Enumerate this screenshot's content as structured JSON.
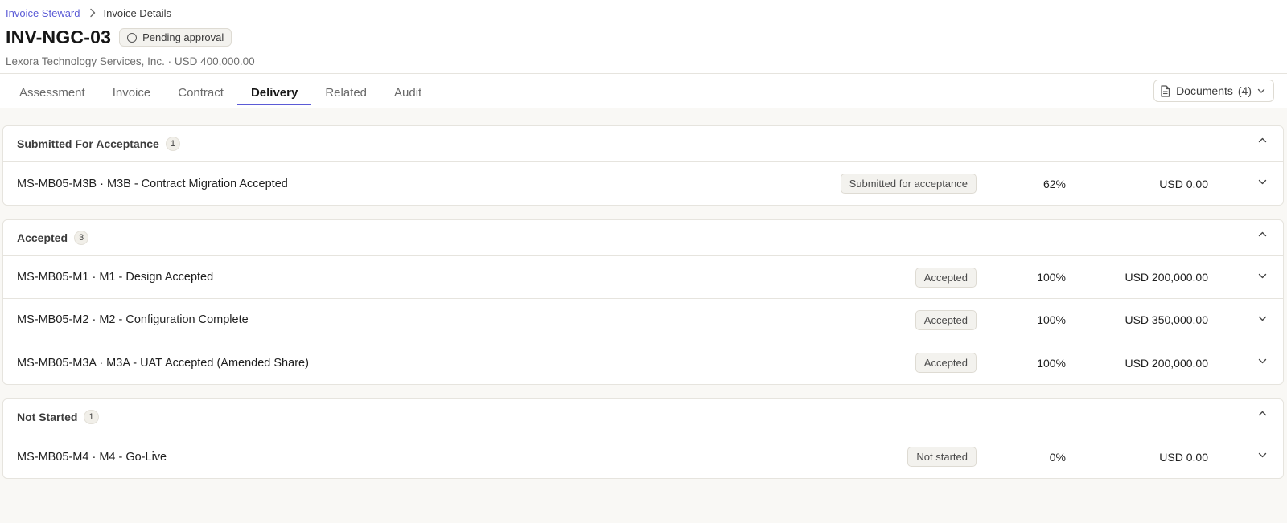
{
  "breadcrumb": {
    "root": "Invoice Steward",
    "current": "Invoice Details"
  },
  "invoice": {
    "id": "INV-NGC-03",
    "status": "Pending approval",
    "subtitle": "Lexora Technology Services, Inc. · USD 400,000.00"
  },
  "tabs": [
    {
      "label": "Assessment"
    },
    {
      "label": "Invoice"
    },
    {
      "label": "Contract"
    },
    {
      "label": "Delivery"
    },
    {
      "label": "Related"
    },
    {
      "label": "Audit"
    }
  ],
  "active_tab": "Delivery",
  "documents": {
    "label": "Documents",
    "count": "(4)"
  },
  "groups": [
    {
      "title": "Submitted For Acceptance",
      "count": "1",
      "rows": [
        {
          "name": "MS-MB05-M3B · M3B - Contract Migration Accepted",
          "status": "Submitted for acceptance",
          "pct": "62%",
          "amount": "USD 0.00"
        }
      ]
    },
    {
      "title": "Accepted",
      "count": "3",
      "rows": [
        {
          "name": "MS-MB05-M1 · M1 - Design Accepted",
          "status": "Accepted",
          "pct": "100%",
          "amount": "USD 200,000.00"
        },
        {
          "name": "MS-MB05-M2 · M2 - Configuration Complete",
          "status": "Accepted",
          "pct": "100%",
          "amount": "USD 350,000.00"
        },
        {
          "name": "MS-MB05-M3A · M3A - UAT Accepted (Amended Share)",
          "status": "Accepted",
          "pct": "100%",
          "amount": "USD 200,000.00"
        }
      ]
    },
    {
      "title": "Not Started",
      "count": "1",
      "rows": [
        {
          "name": "MS-MB05-M4 · M4 - Go-Live",
          "status": "Not started",
          "pct": "0%",
          "amount": "USD 0.00"
        }
      ]
    }
  ],
  "colors": {
    "accent": "#5b5bd6",
    "background": "#f9f8f5",
    "border": "#e6e4de"
  }
}
